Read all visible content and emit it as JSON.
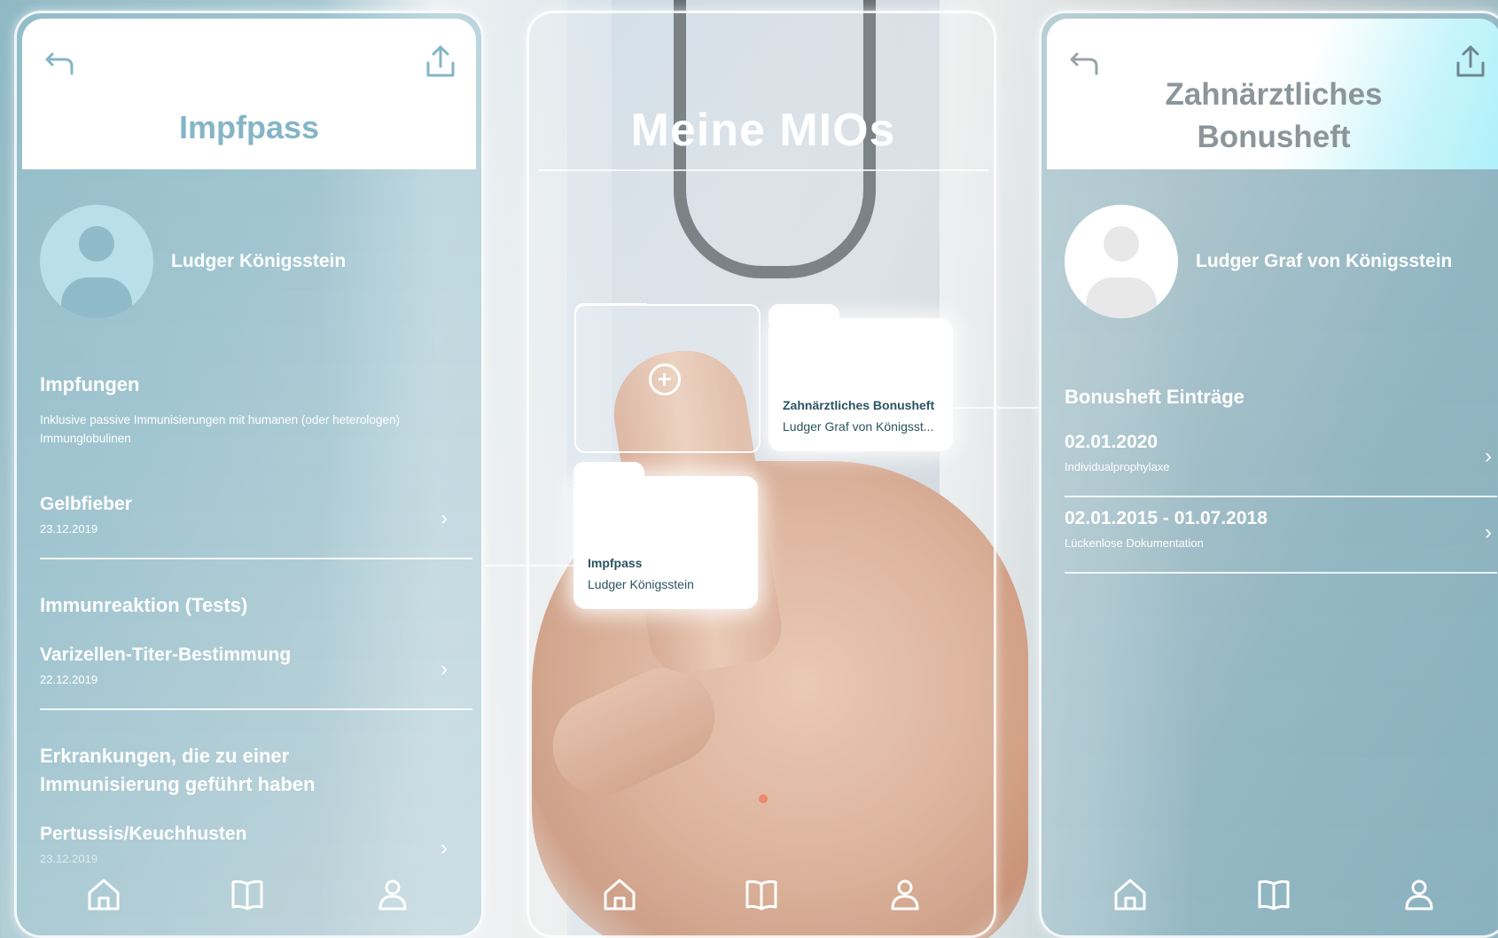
{
  "left": {
    "title": "Impfpass",
    "patient_name": "Ludger Königsstein",
    "section1_title": "Impfungen",
    "section1_note": "Inklusive passive Immunisierungen mit humanen (oder heterologen) Immunglobulinen",
    "item1_name": "Gelbfieber",
    "item1_date": "23.12.2019",
    "section2_title": "Immunreaktion (Tests)",
    "item2_name": "Varizellen-Titer-Bestimmung",
    "item2_date": "22.12.2019",
    "section3_title": "Erkrankungen, die zu einer Immunisierung geführt haben",
    "item3_name": "Pertussis/Keuchhusten",
    "item3_date": "23.12.2019"
  },
  "center": {
    "title": "Meine MIOs",
    "folder1_title": "Zahnärztliches Bonusheft",
    "folder1_owner": "Ludger Graf von Königsst...",
    "folder2_title": "Impfpass",
    "folder2_owner": "Ludger Königsstein"
  },
  "right": {
    "title_line1": "Zahnärztliches",
    "title_line2": "Bonusheft",
    "patient_name": "Ludger Graf von Königsstein",
    "section_title": "Bonusheft Einträge",
    "item1_name": "02.01.2020",
    "item1_desc": "Individualprophylaxe",
    "item2_name": "02.01.2015 - 01.07.2018",
    "item2_desc": "Lückenlose Dokumentation"
  },
  "icons": [
    "back-arrow-icon",
    "share-icon",
    "home-icon",
    "book-icon",
    "user-icon",
    "plus-icon",
    "chevron-right-icon"
  ],
  "colors": {
    "accent": "#84b5c6",
    "white": "#ffffff",
    "folder_text": "#2b5462"
  }
}
